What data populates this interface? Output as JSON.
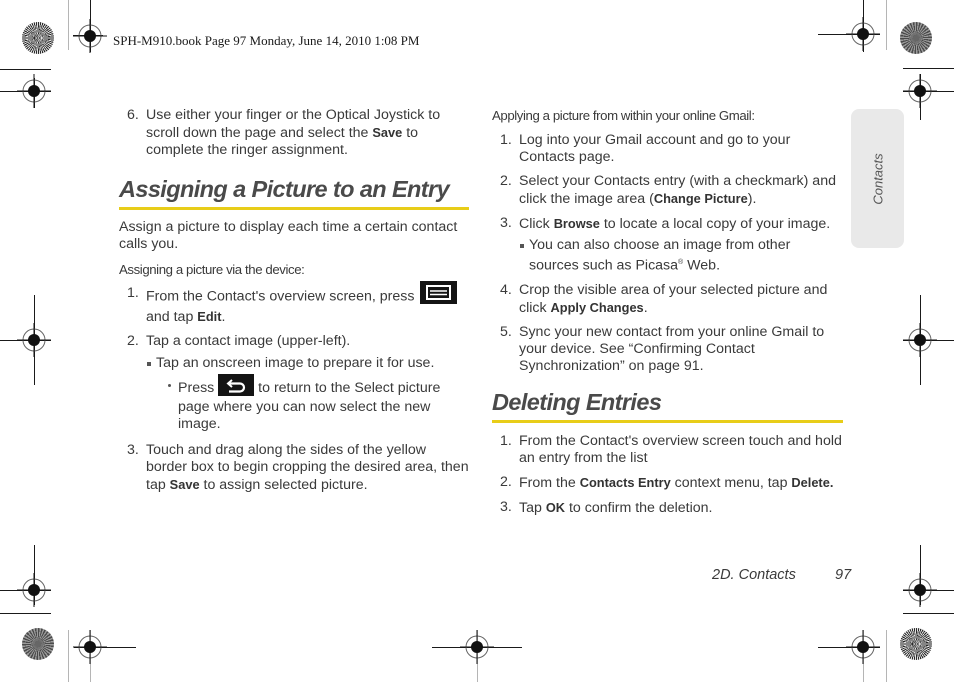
{
  "print_header": "SPH-M910.book  Page 97  Monday, June 14, 2010  1:08 PM",
  "left_column": {
    "step6": {
      "num": "6.",
      "text_a": "Use either your finger or the Optical Joystick to scroll down the page and select the ",
      "bold": "Save",
      "text_b": " to complete the ringer assignment."
    },
    "section1": {
      "title": "Assigning a Picture to an Entry",
      "intro": "Assign a picture to display each time a certain contact calls you.",
      "subhead": "Assigning a picture via the device:",
      "steps": [
        {
          "num": "1.",
          "text_a": "From the Contact's overview screen, press ",
          "icon": "menu-key-icon",
          "text_b": " and tap ",
          "bold": "Edit",
          "text_c": "."
        },
        {
          "num": "2.",
          "text": "Tap a contact image (upper-left).",
          "bullet": "Tap an onscreen image to prepare it for use.",
          "sub_bullet": {
            "text_a": "Press ",
            "icon": "back-key-icon",
            "text_b": " to return to the Select picture page where you can now select the new image."
          }
        },
        {
          "num": "3.",
          "text_a": "Touch and drag along the sides of the yellow border box to begin cropping the desired area, then tap ",
          "bold": "Save",
          "text_b": " to assign selected picture."
        }
      ]
    }
  },
  "right_column": {
    "subhead": "Applying a picture from within your online Gmail:",
    "steps": [
      {
        "num": "1.",
        "text": "Log into your Gmail account and go to your Contacts page."
      },
      {
        "num": "2.",
        "text_a": "Select your Contacts entry (with a checkmark) and click the image area (",
        "bold": "Change Picture",
        "text_b": ")."
      },
      {
        "num": "3.",
        "text_a": "Click ",
        "bold": "Browse",
        "text_b": " to locate a local copy of your image.",
        "bullet_a": "You can also choose an image from other sources such as Picasa",
        "bullet_sup": "®",
        "bullet_b": " Web."
      },
      {
        "num": "4.",
        "text_a": "Crop the visible area of your selected picture and click ",
        "bold": "Apply Changes",
        "text_b": "."
      },
      {
        "num": "5.",
        "text": "Sync your new contact from your online Gmail to your device. See “Confirming Contact Synchronization” on page 91."
      }
    ],
    "section2": {
      "title": "Deleting Entries",
      "steps": [
        {
          "num": "1.",
          "text": "From the Contact's overview screen touch and hold an entry from the list"
        },
        {
          "num": "2.",
          "text_a": "From the ",
          "bold_a": "Contacts Entry",
          "text_b": " context menu, tap ",
          "bold_b": "Delete",
          "text_c": "."
        },
        {
          "num": "3.",
          "text_a": "Tap ",
          "bold": "OK",
          "text_b": " to confirm the deletion."
        }
      ]
    }
  },
  "side_tab": {
    "label": "Contacts"
  },
  "footer": {
    "section": "2D. Contacts",
    "page": "97"
  },
  "colors": {
    "accent_rule": "#e8cd18",
    "side_tab_bg": "#e9e9e9",
    "text": "#3a3a3a"
  }
}
